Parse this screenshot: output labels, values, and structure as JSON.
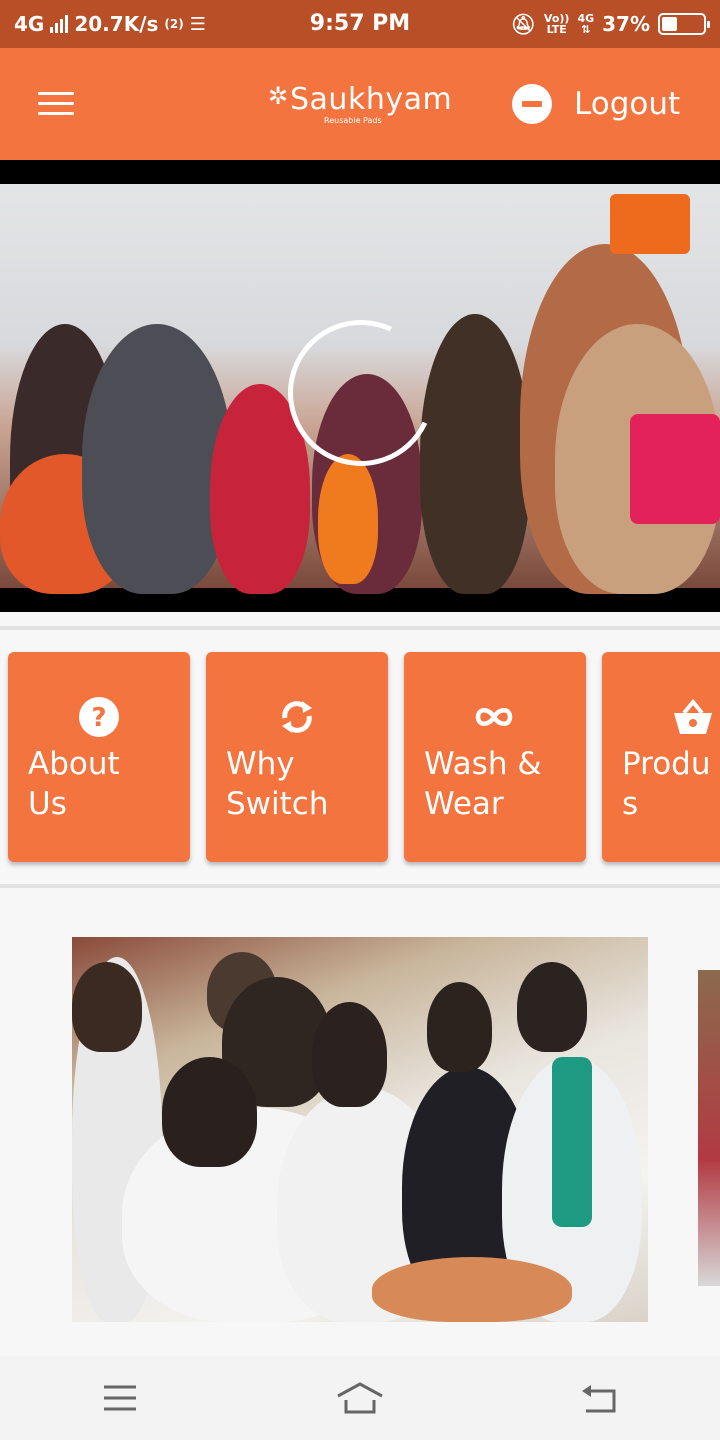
{
  "status_bar": {
    "network": "4G",
    "speed": "20.7K/s",
    "sim_tag": "(2)",
    "time": "9:57 PM",
    "volte_top": "Vo))",
    "volte_bottom": "LTE",
    "network_right": "4G",
    "battery": "37%",
    "battery_level": 0.37
  },
  "app_bar": {
    "menu_icon": "hamburger-menu-icon",
    "logo_text": "Saukhyam",
    "logo_subtitle": "Reusable Pads",
    "logout_label": "Logout",
    "logout_icon": "minus-circle-icon",
    "color": "#f3743e"
  },
  "hero": {
    "loading_icon": "loading-spinner-icon"
  },
  "categories": [
    {
      "label": "About\nUs",
      "icon": "question-circle-icon"
    },
    {
      "label": "Why\nSwitch",
      "icon": "sync-icon"
    },
    {
      "label": "Wash &\nWear",
      "icon": "infinity-icon"
    },
    {
      "label": "Produ\ns",
      "icon": "basket-icon"
    }
  ],
  "nav_bar": {
    "menu": "menu-lines-icon",
    "home": "home-icon",
    "back": "back-arrow-icon"
  }
}
